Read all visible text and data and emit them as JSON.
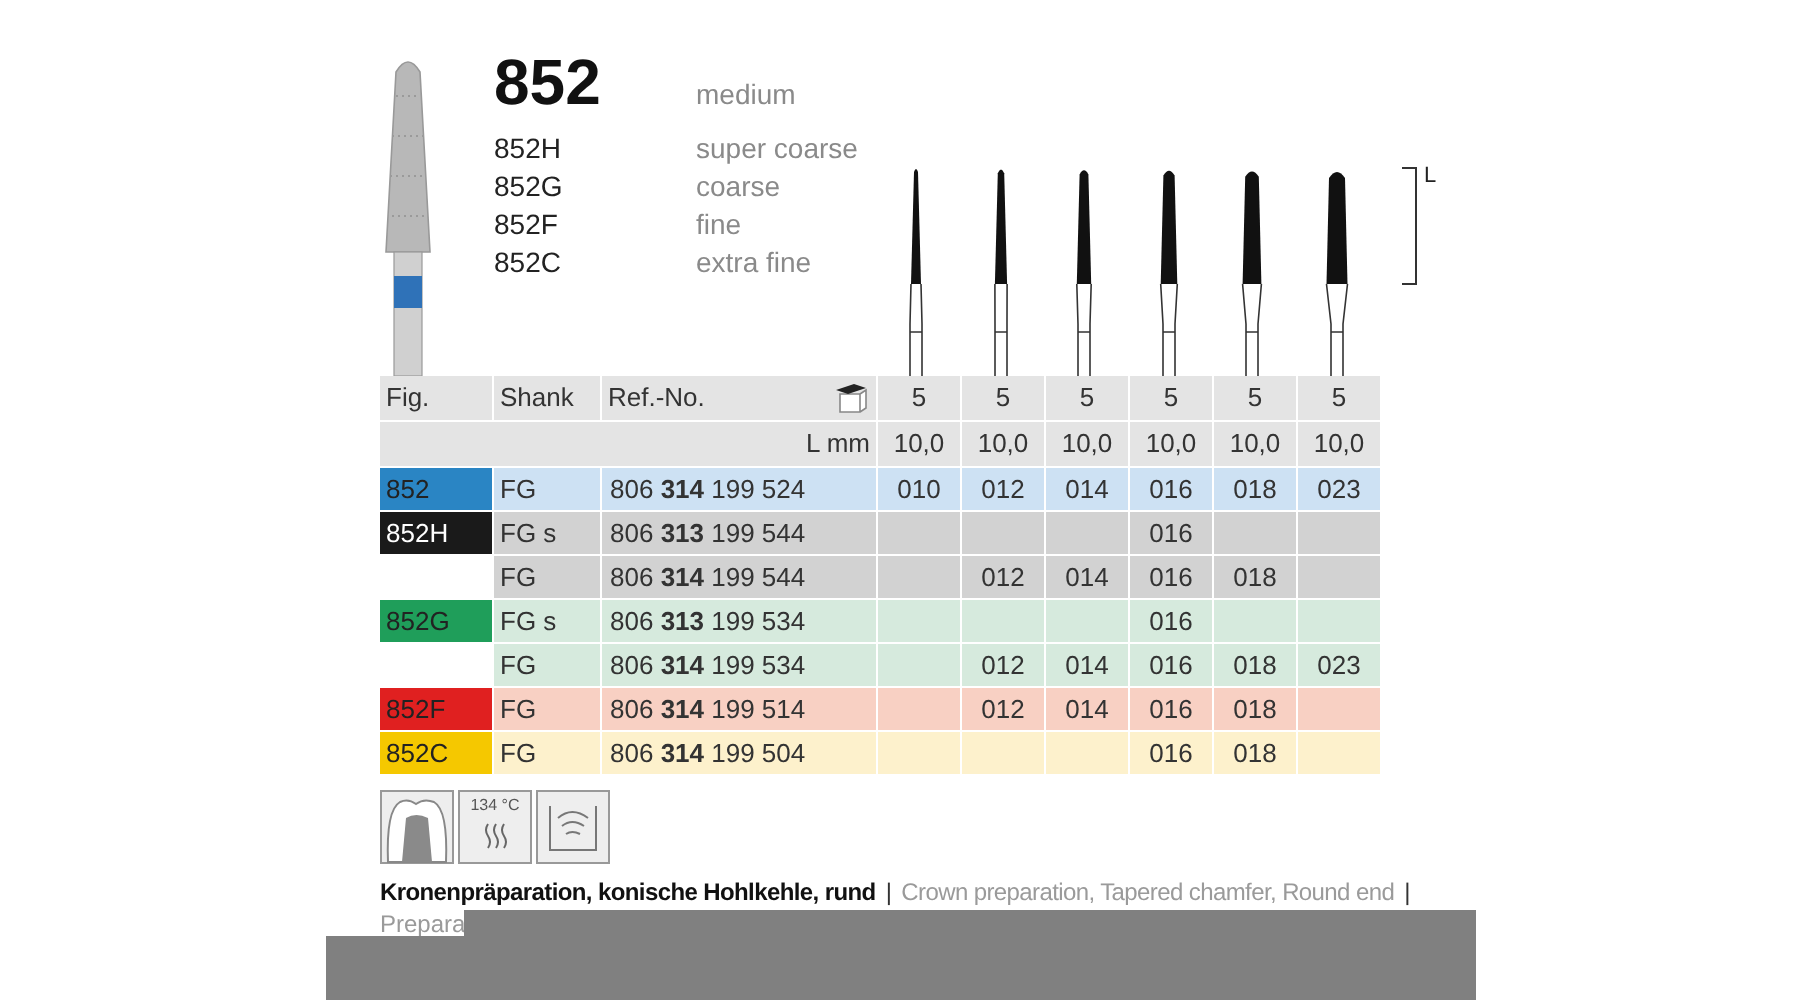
{
  "product": {
    "title": "852",
    "title_grade": "medium",
    "grades": [
      {
        "code": "852H",
        "name": "super coarse"
      },
      {
        "code": "852G",
        "name": "coarse"
      },
      {
        "code": "852F",
        "name": "fine"
      },
      {
        "code": "852C",
        "name": "extra fine"
      }
    ],
    "length_label": "L"
  },
  "table": {
    "columns": [
      "Fig.",
      "Shank",
      "Ref.-No."
    ],
    "pack_sizes": [
      "5",
      "5",
      "5",
      "5",
      "5",
      "5"
    ],
    "length_unit": "L mm",
    "lengths": [
      "10,0",
      "10,0",
      "10,0",
      "10,0",
      "10,0",
      "10,0"
    ],
    "rows": [
      {
        "fig": {
          "label": "852",
          "color": "#2a85c4"
        },
        "color": "#cde1f3",
        "shank": "FG",
        "ref": "806 **314** 199 524",
        "sizes": {
          "column_1": "010",
          "column_2": "012",
          "column_3": "014",
          "column_4": "016",
          "column_5": "018",
          "column_6": "023"
        }
      },
      {
        "fig": {
          "label": "852H",
          "color": "#1a1a1a"
        },
        "color": "#d2d2d2",
        "shank": "FG s",
        "ref": "806 **313** 199 544",
        "sizes": {
          "column_4": "016"
        }
      },
      {
        "color": "#d2d2d2",
        "shank": "FG",
        "ref": "806 **314** 199 544",
        "sizes": {
          "column_2": "012",
          "column_3": "014",
          "column_4": "016",
          "column_5": "018"
        }
      },
      {
        "fig": {
          "label": "852G",
          "color": "#1f9e5a"
        },
        "color": "#d6eadd",
        "shank": "FG s",
        "ref": "806 **313** 199 534",
        "sizes": {
          "column_4": "016"
        }
      },
      {
        "color": "#d6eadd",
        "shank": "FG",
        "ref": "806 **314** 199 534",
        "sizes": {
          "column_2": "012",
          "column_3": "014",
          "column_4": "016",
          "column_5": "018",
          "column_6": "023"
        }
      },
      {
        "fig": {
          "label": "852F",
          "color": "#e02020"
        },
        "color": "#f8d0c3",
        "shank": "FG",
        "ref": "806 **314** 199 514",
        "sizes": {
          "column_2": "012",
          "column_3": "014",
          "column_4": "016",
          "column_5": "018"
        }
      },
      {
        "fig": {
          "label": "852C",
          "color": "#f5c800"
        },
        "color": "#fdf1cc",
        "shank": "FG",
        "ref": "806 **314** 199 504",
        "sizes": {
          "column_4": "016",
          "column_5": "018"
        }
      }
    ]
  },
  "footer": {
    "sterilization_label": "134 °C",
    "description_de": "Kronenpräparation, konische Hohlkehle, rund",
    "separator_1": "|",
    "description_en": "Crown preparation, Tapered chamfer, Round end",
    "separator_2": "|",
    "description_cut": "Prepara"
  }
}
